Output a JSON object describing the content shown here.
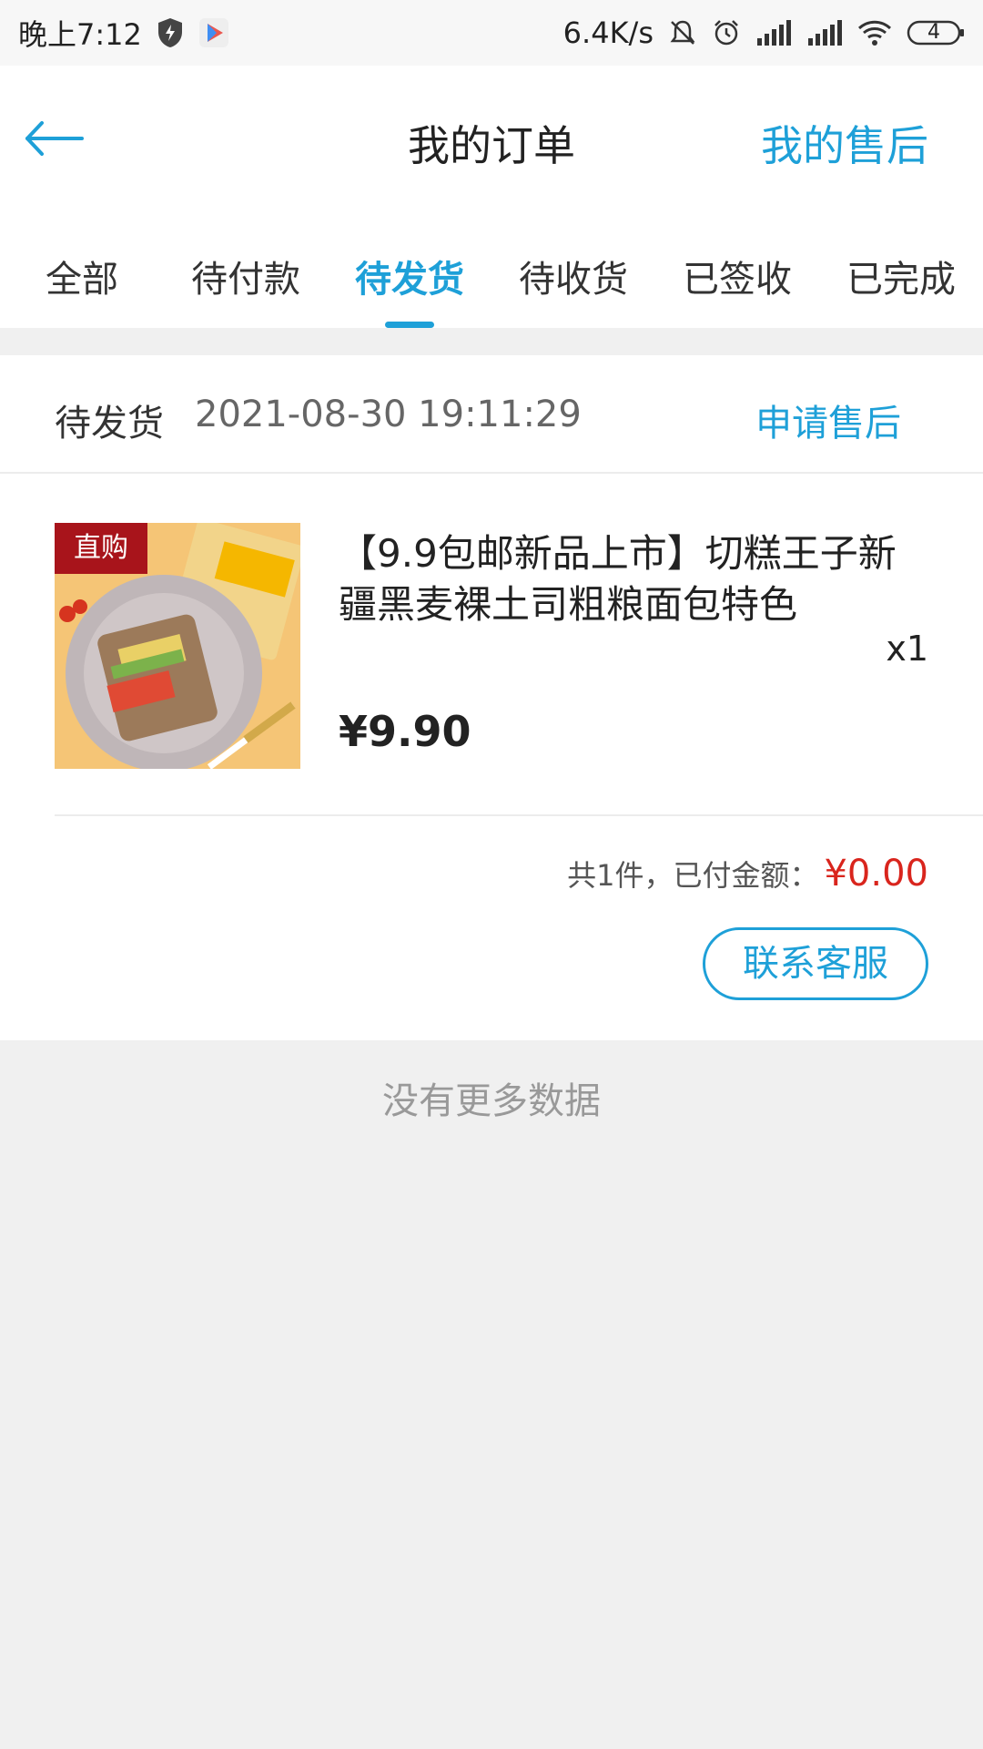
{
  "status_bar": {
    "time": "晚上7:12",
    "net_speed": "6.4K/s",
    "battery": "4"
  },
  "header": {
    "title": "我的订单",
    "aftersale_link": "我的售后"
  },
  "tabs": [
    {
      "label": "全部"
    },
    {
      "label": "待付款"
    },
    {
      "label": "待发货"
    },
    {
      "label": "待收货"
    },
    {
      "label": "已签收"
    },
    {
      "label": "已完成"
    }
  ],
  "active_tab": 2,
  "order": {
    "status": "待发货",
    "time": "2021-08-30 19:11:29",
    "apply_aftersale": "申请售后",
    "item": {
      "badge": "直购",
      "title": "【9.9包邮新品上市】切糕王子新疆黑麦裸土司粗粮面包特色",
      "qty": "x1",
      "price": "¥9.90"
    },
    "summary_label": "共1件，已付金额：",
    "paid_amount": "¥0.00",
    "contact_button": "联系客服"
  },
  "footer_text": "没有更多数据",
  "colors": {
    "accent": "#1ea0d8",
    "price_red": "#d9251d",
    "badge_red": "#a8141b"
  }
}
